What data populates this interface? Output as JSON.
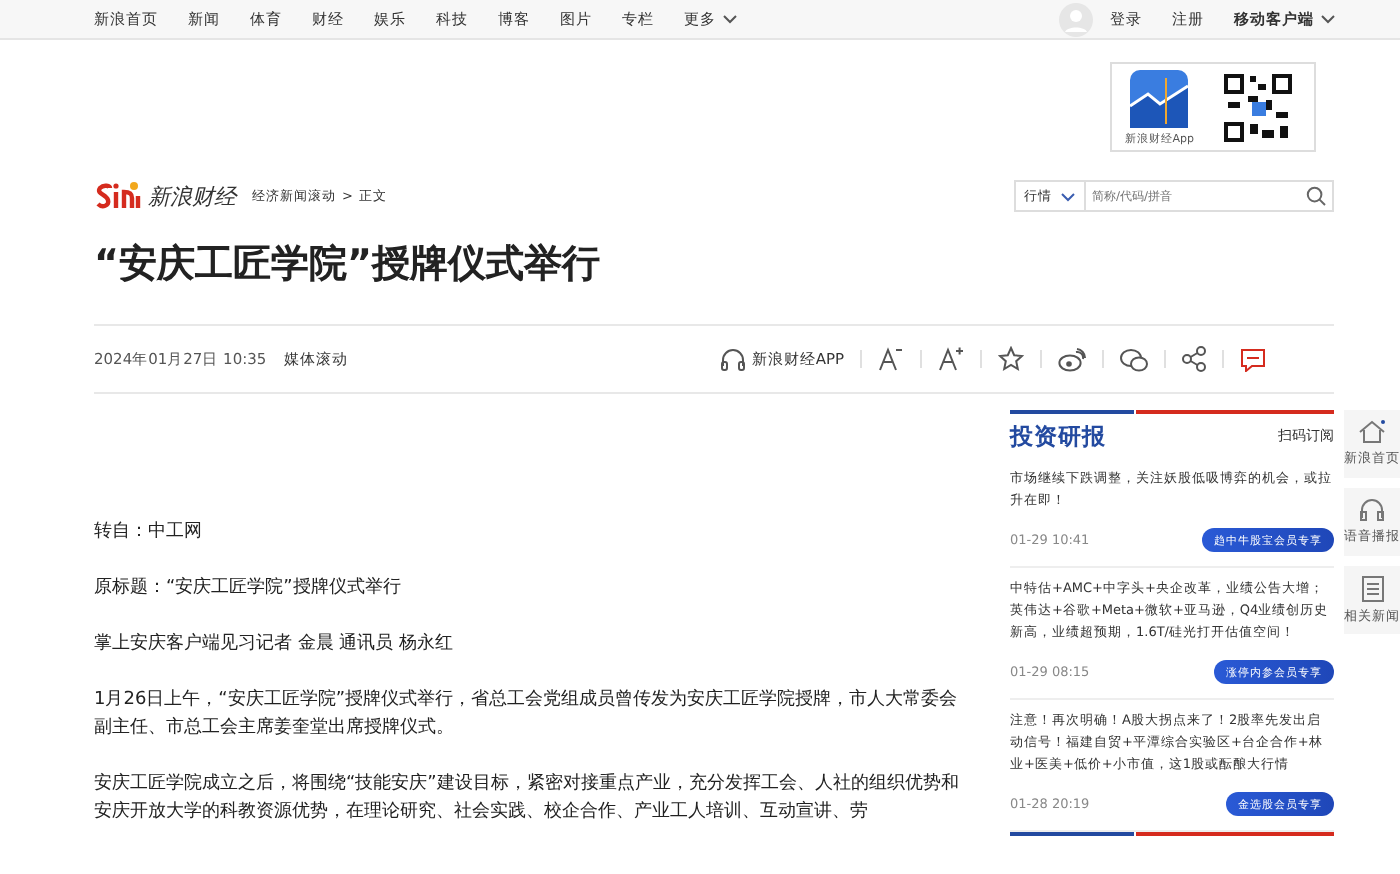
{
  "top_nav": {
    "items": [
      "新浪首页",
      "新闻",
      "体育",
      "财经",
      "娱乐",
      "科技",
      "博客",
      "图片",
      "专栏"
    ],
    "more": "更多",
    "login": "登录",
    "register": "注册",
    "mobile": "移动客户端"
  },
  "app_promo": {
    "caption": "新浪财经App"
  },
  "header": {
    "logo_text": "新浪财经",
    "breadcrumb": [
      "经济新闻滚动",
      "正文"
    ],
    "breadcrumb_sep": ">",
    "search_select": "行情",
    "search_placeholder": "简称/代码/拼音"
  },
  "article": {
    "title": "“安庆工匠学院”授牌仪式举行",
    "date": "2024年01月27日 10:35",
    "source": "媒体滚动",
    "app_link": "新浪财经APP",
    "paragraphs": [
      "转自：中工网",
      "原标题：“安庆工匠学院”授牌仪式举行",
      "掌上安庆客户端见习记者 金晨 通讯员 杨永红",
      "1月26日上午，“安庆工匠学院”授牌仪式举行，省总工会党组成员曾传发为安庆工匠学院授牌，市人大常委会副主任、市总工会主席姜奎堂出席授牌仪式。",
      "安庆工匠学院成立之后，将围绕“技能安庆”建设目标，紧密对接重点产业，充分发挥工会、人社的组织优势和安庆开放大学的科教资源优势，在理论研究、社会实践、校企合作、产业工人培训、互动宣讲、劳"
    ]
  },
  "research": {
    "title": "投资研报",
    "subscribe": "扫码订阅",
    "items": [
      {
        "text": "市场继续下跌调整，关注妖股低吸博弈的机会，或拉升在即！",
        "time": "01-29 10:41",
        "button": "趋中牛股宝会员专享"
      },
      {
        "text": "中特估+AMC+中字头+央企改革，业绩公告大增；英伟达+谷歌+Meta+微软+亚马逊，Q4业绩创历史新高，业绩超预期，1.6T/硅光打开估值空间！",
        "time": "01-29 08:15",
        "button": "涨停内参会员专享"
      },
      {
        "text": "注意！再次明确！A股大拐点来了！2股率先发出启动信号！福建自贸+平潭综合实验区+台企合作+林业+医美+低价+小市值，这1股或酝酿大行情",
        "time": "01-28 20:19",
        "button": "金选股会员专享"
      }
    ]
  },
  "side_tools": [
    "新浪首页",
    "语音播报",
    "相关新闻"
  ]
}
